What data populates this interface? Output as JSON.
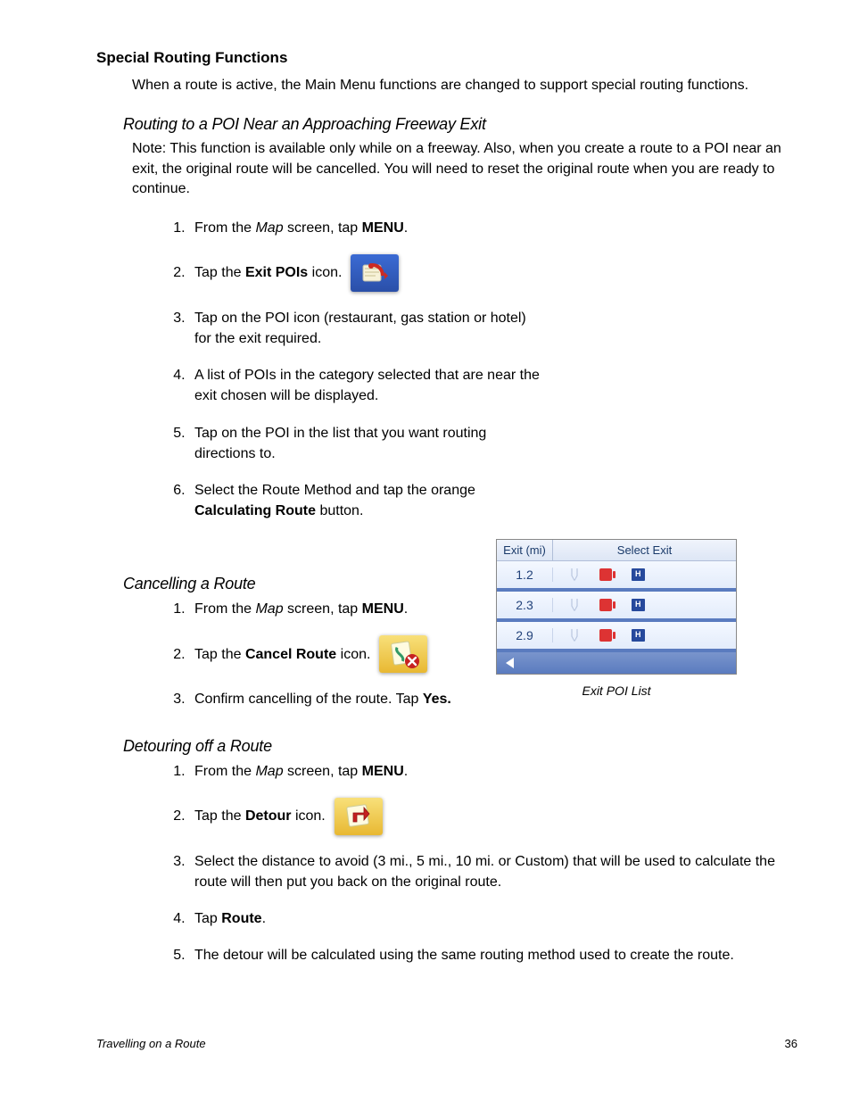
{
  "sectionTitle": "Special Routing Functions",
  "intro": "When a route is active, the Main Menu functions are changed to support special routing functions.",
  "sub1": {
    "title": "Routing to a POI Near an Approaching Freeway Exit",
    "note": "Note: This function is available only while on a freeway.  Also, when you create a route to a POI near an exit, the original route will be cancelled.  You will need to reset the original route when you are ready to continue.",
    "s1a": "From the ",
    "s1b": "Map",
    "s1c": " screen, tap ",
    "s1d": "MENU",
    "s1e": ".",
    "s2a": "Tap the ",
    "s2b": "Exit POIs",
    "s2c": " icon.",
    "s3": "Tap on the POI icon (restaurant, gas station or hotel) for the exit required.",
    "s4": "A list of POIs in the category selected that are near the exit chosen will be displayed.",
    "s5": "Tap on the POI in the list that you want routing directions to.",
    "s6a": "Select the Route Method and tap the orange ",
    "s6b": "Calculating Route",
    "s6c": " button."
  },
  "sub2": {
    "title": "Cancelling a Route",
    "s1a": "From the ",
    "s1b": "Map",
    "s1c": " screen, tap ",
    "s1d": "MENU",
    "s1e": ".",
    "s2a": "Tap the ",
    "s2b": "Cancel Route",
    "s2c": " icon.",
    "s3a": "Confirm cancelling of the route.  Tap ",
    "s3b": "Yes."
  },
  "sub3": {
    "title": "Detouring off a Route",
    "s1a": "From the ",
    "s1b": "Map",
    "s1c": " screen, tap ",
    "s1d": "MENU",
    "s1e": ".",
    "s2a": "Tap the ",
    "s2b": "Detour",
    "s2c": " icon.",
    "s3": "Select the distance to avoid (3 mi., 5 mi., 10 mi. or Custom) that will be used to calculate the route will then put you back on the original route.",
    "s4a": "Tap ",
    "s4b": "Route",
    "s4c": ".",
    "s5": "The detour will be calculated using the same routing method used to create the route."
  },
  "figure": {
    "caption": "Exit POI List",
    "hdrLeft": "Exit (mi)",
    "hdrRight": "Select Exit",
    "rows": [
      {
        "dist": "1.2"
      },
      {
        "dist": "2.3"
      },
      {
        "dist": "2.9"
      }
    ]
  },
  "footerLeft": "Travelling on a Route",
  "footerRight": "36"
}
